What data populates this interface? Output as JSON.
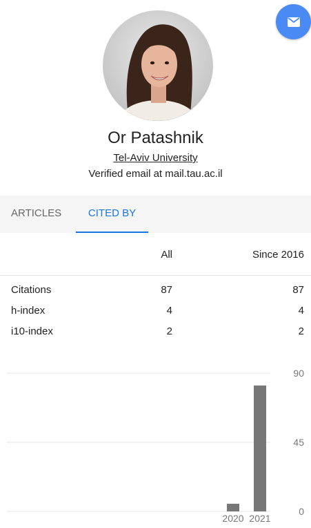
{
  "profile": {
    "name": "Or Patashnik",
    "affiliation": "Tel-Aviv University",
    "verified": "Verified email at mail.tau.ac.il"
  },
  "email_button": {
    "icon": "envelope-icon",
    "color": "#4a8af4"
  },
  "tabs": [
    {
      "label": "ARTICLES",
      "active": false
    },
    {
      "label": "CITED BY",
      "active": true
    }
  ],
  "stats": {
    "headers": {
      "all": "All",
      "since": "Since 2016"
    },
    "rows": [
      {
        "label": "Citations",
        "all": "87",
        "since": "87"
      },
      {
        "label": "h-index",
        "all": "4",
        "since": "4"
      },
      {
        "label": "i10-index",
        "all": "2",
        "since": "2"
      }
    ]
  },
  "chart_data": {
    "type": "bar",
    "categories": [
      "2020",
      "2021"
    ],
    "values": [
      5,
      82
    ],
    "title": "",
    "xlabel": "",
    "ylabel": "",
    "ylim": [
      0,
      90
    ],
    "yticks": [
      "90",
      "45",
      "0"
    ],
    "grid": true,
    "bar_color": "#777777"
  }
}
